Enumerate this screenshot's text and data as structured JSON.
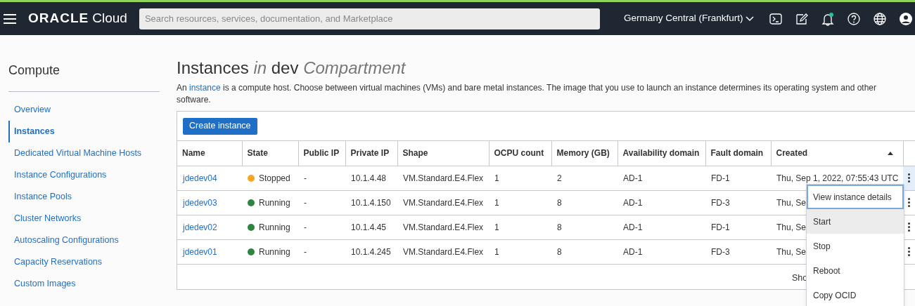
{
  "header": {
    "brand": "ORACLE",
    "product": "Cloud",
    "search": {
      "placeholder": "Search resources, services, documentation, and Marketplace"
    },
    "region": "Germany Central (Frankfurt)",
    "notification_unread": true
  },
  "sidebar": {
    "title": "Compute",
    "items": [
      {
        "label": "Overview",
        "selected": false
      },
      {
        "label": "Instances",
        "selected": true
      },
      {
        "label": "Dedicated Virtual Machine Hosts",
        "selected": false
      },
      {
        "label": "Instance Configurations",
        "selected": false
      },
      {
        "label": "Instance Pools",
        "selected": false
      },
      {
        "label": "Cluster Networks",
        "selected": false
      },
      {
        "label": "Autoscaling Configurations",
        "selected": false
      },
      {
        "label": "Capacity Reservations",
        "selected": false
      },
      {
        "label": "Custom Images",
        "selected": false
      }
    ]
  },
  "page": {
    "title": [
      "Instances",
      "in",
      "dev",
      "Compartment"
    ],
    "description": {
      "before": "An",
      "link": "instance",
      "after": "is a compute host. Choose between virtual machines (VMs) and bare metal instances. The image that you use to launch an instance determines its operating system and other software."
    },
    "create_button": "Create instance"
  },
  "table": {
    "columns": [
      {
        "label": "Name",
        "sorted": false
      },
      {
        "label": "State",
        "sorted": false
      },
      {
        "label": "Public IP",
        "sorted": false
      },
      {
        "label": "Private IP",
        "sorted": false
      },
      {
        "label": "Shape",
        "sorted": false
      },
      {
        "label": "OCPU count",
        "sorted": false
      },
      {
        "label": "Memory (GB)",
        "sorted": false
      },
      {
        "label": "Availability domain",
        "sorted": false
      },
      {
        "label": "Fault domain",
        "sorted": false
      },
      {
        "label": "Created",
        "sorted": true
      }
    ],
    "rows": [
      {
        "name": "jdedev04",
        "state": "Stopped",
        "color": "#f5a623",
        "public_ip": "-",
        "private_ip": "10.1.4.48",
        "shape": "VM.Standard.E4.Flex",
        "ocpu": "1",
        "memory": "2",
        "ad": "AD-1",
        "fd": "FD-1",
        "created": "Thu, Sep 1, 2022, 07:55:43 UTC",
        "menu_open": true
      },
      {
        "name": "jdedev03",
        "state": "Running",
        "color": "#2e8540",
        "public_ip": "-",
        "private_ip": "10.1.4.150",
        "shape": "VM.Standard.E4.Flex",
        "ocpu": "1",
        "memory": "8",
        "ad": "AD-1",
        "fd": "FD-3",
        "created": "Thu, Se",
        "menu_open": false
      },
      {
        "name": "jdedev02",
        "state": "Running",
        "color": "#2e8540",
        "public_ip": "-",
        "private_ip": "10.1.4.45",
        "shape": "VM.Standard.E4.Flex",
        "ocpu": "1",
        "memory": "8",
        "ad": "AD-1",
        "fd": "FD-1",
        "created": "Thu, Se",
        "menu_open": false
      },
      {
        "name": "jdedev01",
        "state": "Running",
        "color": "#2e8540",
        "public_ip": "-",
        "private_ip": "10.1.4.245",
        "shape": "VM.Standard.E4.Flex",
        "ocpu": "1",
        "memory": "8",
        "ad": "AD-1",
        "fd": "FD-3",
        "created": "Thu, Se",
        "menu_open": false
      }
    ],
    "footer": "Sho"
  },
  "action_menu": {
    "items": [
      {
        "label": "View instance details",
        "focused": true,
        "hovered": false
      },
      {
        "label": "Start",
        "focused": false,
        "hovered": true
      },
      {
        "label": "Stop",
        "focused": false,
        "hovered": false
      },
      {
        "label": "Reboot",
        "focused": false,
        "hovered": false
      },
      {
        "label": "Copy OCID",
        "focused": false,
        "hovered": false
      }
    ]
  }
}
